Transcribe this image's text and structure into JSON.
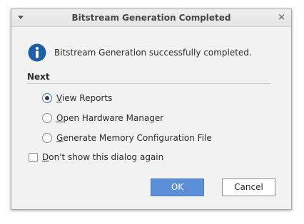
{
  "window": {
    "title": "Bitstream Generation Completed",
    "close_glyph": "×"
  },
  "message": {
    "icon": "info-icon",
    "text": "Bitstream Generation successfully completed."
  },
  "next": {
    "heading": "Next",
    "options": [
      {
        "mnemonic": "V",
        "rest": "iew Reports",
        "selected": true
      },
      {
        "mnemonic": "O",
        "rest": "pen Hardware Manager",
        "selected": false
      },
      {
        "mnemonic": "G",
        "rest": "enerate Memory Configuration File",
        "selected": false
      }
    ]
  },
  "dont_show": {
    "mnemonic": "D",
    "rest": "on't show this dialog again",
    "checked": false
  },
  "buttons": {
    "ok": "OK",
    "cancel": "Cancel"
  },
  "colors": {
    "accent": "#5b8fd8",
    "info_icon": "#1f5fa8"
  }
}
